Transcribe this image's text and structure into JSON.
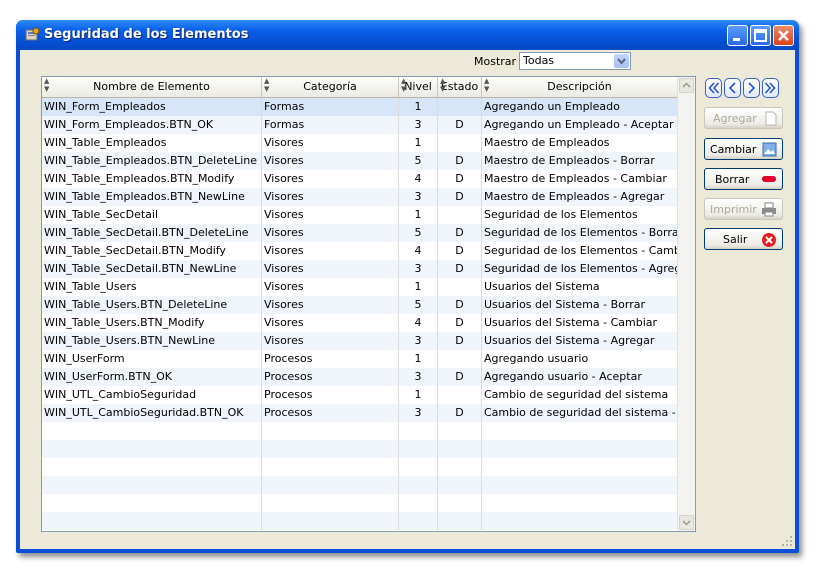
{
  "window": {
    "title": "Seguridad de los Elementos"
  },
  "filter": {
    "label": "Mostrar",
    "selected": "Todas"
  },
  "table": {
    "headers": [
      "Nombre de Elemento",
      "Categoría",
      "Nivel",
      "Estado",
      "Descripción"
    ],
    "rows": [
      [
        "WIN_Form_Empleados",
        "Formas",
        "1",
        "",
        "Agregando un Empleado"
      ],
      [
        "WIN_Form_Empleados.BTN_OK",
        "Formas",
        "3",
        "D",
        "Agregando un Empleado - Aceptar"
      ],
      [
        "WIN_Table_Empleados",
        "Visores",
        "1",
        "",
        "Maestro de Empleados"
      ],
      [
        "WIN_Table_Empleados.BTN_DeleteLine",
        "Visores",
        "5",
        "D",
        "Maestro de Empleados - Borrar"
      ],
      [
        "WIN_Table_Empleados.BTN_Modify",
        "Visores",
        "4",
        "D",
        "Maestro de Empleados - Cambiar"
      ],
      [
        "WIN_Table_Empleados.BTN_NewLine",
        "Visores",
        "3",
        "D",
        "Maestro de Empleados - Agregar"
      ],
      [
        "WIN_Table_SecDetail",
        "Visores",
        "1",
        "",
        "Seguridad de los Elementos"
      ],
      [
        "WIN_Table_SecDetail.BTN_DeleteLine",
        "Visores",
        "5",
        "D",
        "Seguridad de los Elementos - Borrar"
      ],
      [
        "WIN_Table_SecDetail.BTN_Modify",
        "Visores",
        "4",
        "D",
        "Seguridad de los Elementos - Cambiar"
      ],
      [
        "WIN_Table_SecDetail.BTN_NewLine",
        "Visores",
        "3",
        "D",
        "Seguridad de los Elementos - Agregar"
      ],
      [
        "WIN_Table_Users",
        "Visores",
        "1",
        "",
        "Usuarios del Sistema"
      ],
      [
        "WIN_Table_Users.BTN_DeleteLine",
        "Visores",
        "5",
        "D",
        "Usuarios del Sistema - Borrar"
      ],
      [
        "WIN_Table_Users.BTN_Modify",
        "Visores",
        "4",
        "D",
        "Usuarios del Sistema - Cambiar"
      ],
      [
        "WIN_Table_Users.BTN_NewLine",
        "Visores",
        "3",
        "D",
        "Usuarios del Sistema - Agregar"
      ],
      [
        "WIN_UserForm",
        "Procesos",
        "1",
        "",
        "Agregando usuario"
      ],
      [
        "WIN_UserForm.BTN_OK",
        "Procesos",
        "3",
        "D",
        "Agregando usuario - Aceptar"
      ],
      [
        "WIN_UTL_CambioSeguridad",
        "Procesos",
        "1",
        "",
        "Cambio de seguridad del sistema"
      ],
      [
        "WIN_UTL_CambioSeguridad.BTN_OK",
        "Procesos",
        "3",
        "D",
        "Cambio de seguridad del sistema - Aceptar"
      ]
    ],
    "selected_row": 0
  },
  "actions": {
    "agregar": "Agregar",
    "cambiar": "Cambiar",
    "borrar": "Borrar",
    "imprimir": "Imprimir",
    "salir": "Salir"
  },
  "colors": {
    "titlebar": "#0a5ee8",
    "selection": "#d6e6f8",
    "close_icon": "#e02020",
    "delete_icon": "#e0002a"
  }
}
